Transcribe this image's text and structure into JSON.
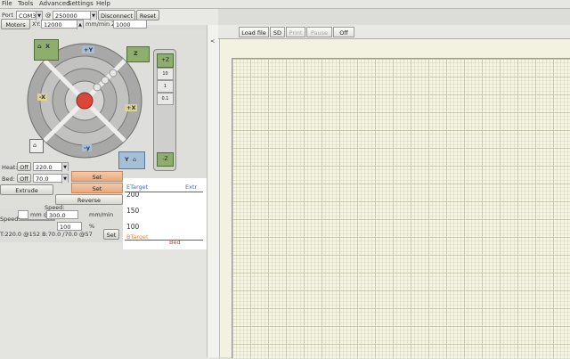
{
  "menu": {
    "file": "File",
    "tools": "Tools",
    "advanced": "Advanced",
    "settings": "Settings",
    "help": "Help"
  },
  "connection": {
    "port_label": "Port",
    "port_value": "COM38",
    "at_label": "@",
    "baud_value": "250000",
    "disconnect_label": "Disconnect",
    "reset_label": "Reset"
  },
  "motors": {
    "motors_off_label": "Motors off",
    "xy_label": "XY:",
    "xy_speed": "12000",
    "xy_unit": "mm/min Z:",
    "z_speed": "1000"
  },
  "jog": {
    "home_x": "X",
    "home_y": "Y",
    "home_z": "Z",
    "minus_x": "-X",
    "plus_x": "+X",
    "plus_y": "+Y",
    "minus_y": "-y",
    "plus_z": "+Z",
    "minus_z": "-Z",
    "steps_y": [
      "100",
      "10",
      "1",
      "0.1"
    ],
    "steps_z": [
      "10",
      "1",
      "0.1"
    ]
  },
  "temps": {
    "heat_label": "Heat:",
    "heat_off": "Off",
    "heat_value": "220.0",
    "bed_label": "Bed:",
    "bed_off": "Off",
    "bed_value": "70.0",
    "set_label": "Set"
  },
  "extrude": {
    "extrude_label": "Extrude",
    "reverse_label": "Reverse",
    "speed_label": "Speed:",
    "length_unit": "mm @",
    "length_value": "5.0",
    "speed_value": "300.0",
    "speed_unit": "mm/min",
    "print_speed_label": "Speed:",
    "print_speed_value": "100",
    "percent_unit": "%",
    "set_label": "Set",
    "status_line": "T:220.0 @152 B:70.0 /70.0 @57"
  },
  "graph": {
    "ytick_200": "200",
    "ytick_150": "150",
    "ytick_100": "100",
    "legend_target_top": "ETarget",
    "legend_extr": "Extr",
    "legend_target_bottom": "BTarget",
    "legend_bed": "Bed",
    "colors": {
      "target": "#3a6cc9",
      "bed": "#d23a2a",
      "btarget": "#e08030"
    }
  },
  "toolbar": {
    "collapse": "<",
    "load_file": "Load file",
    "sd": "SD",
    "print": "Print",
    "pause": "Pause",
    "off": "Off"
  }
}
